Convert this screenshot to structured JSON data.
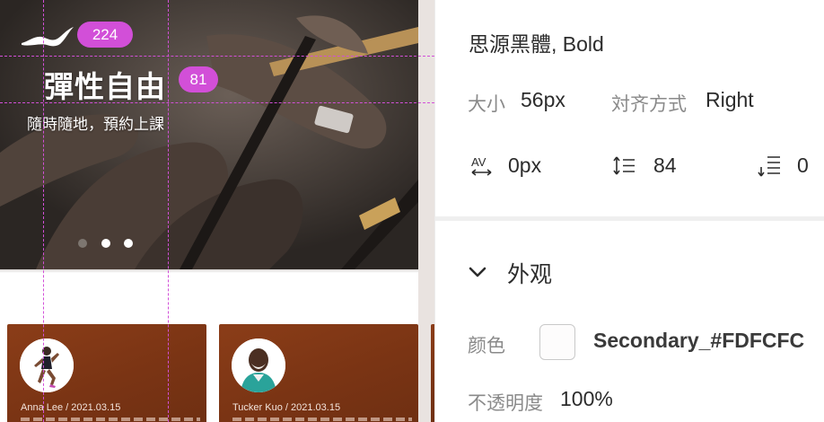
{
  "canvas": {
    "hero": {
      "title": "彈性自由",
      "subtitle": "隨時隨地，預約上課",
      "badge_top": "224",
      "badge_title": "81",
      "carousel_active_index": 2,
      "carousel_count": 3
    },
    "cards": [
      {
        "meta": "Anna Lee / 2021.03.15"
      },
      {
        "meta": "Tucker Kuo / 2021.03.15"
      }
    ],
    "colors": {
      "guide": "#d24fd8",
      "card_bg": "#7a3414"
    }
  },
  "inspector": {
    "font_name": "思源黑體, Bold",
    "size_label": "大小",
    "size_value": "56px",
    "align_label": "対齐方式",
    "align_value": "Right",
    "char_spacing_icon": "character-spacing-icon",
    "char_spacing_value": "0px",
    "line_spacing_icon": "line-spacing-icon",
    "line_spacing_value": "84",
    "paragraph_spacing_icon": "paragraph-spacing-icon",
    "paragraph_spacing_value": "0",
    "appearance_section": {
      "title": "外观",
      "toggle_icon": "chevron-down-icon",
      "color_label": "颜色",
      "color_value": "Secondary_#FDFCFC",
      "swatch_color": "#FDFCFC",
      "opacity_label": "不透明度",
      "opacity_value": "100%"
    }
  }
}
